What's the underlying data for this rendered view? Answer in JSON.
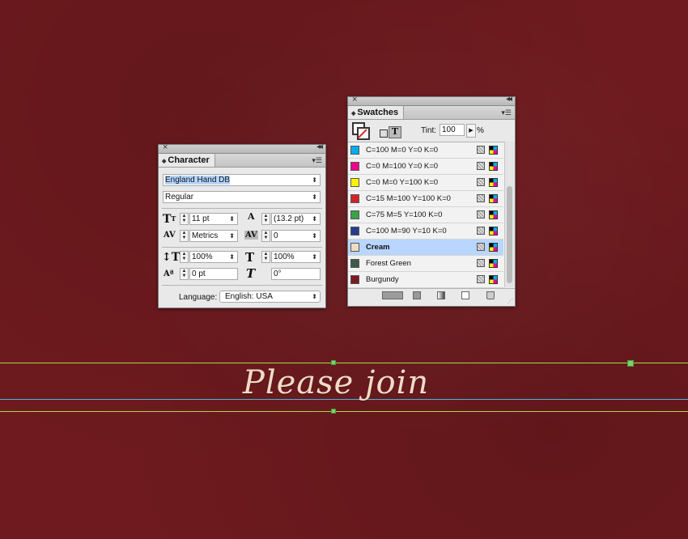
{
  "character_panel": {
    "tab_label": "Character",
    "font_family": "England Hand DB",
    "font_style": "Regular",
    "font_size": "11 pt",
    "leading": "(13.2 pt)",
    "kerning": "Metrics",
    "tracking": "0",
    "vertical_scale": "100%",
    "horizontal_scale": "100%",
    "baseline_shift": "0 pt",
    "skew": "0°",
    "language_label": "Language:",
    "language_value": "English: USA"
  },
  "swatches_panel": {
    "tab_label": "Swatches",
    "tint_label": "Tint:",
    "tint_value": "100",
    "tint_unit": "%",
    "items": [
      {
        "name": "C=100 M=0 Y=0 K=0",
        "color": "#00aeef"
      },
      {
        "name": "C=0 M=100 Y=0 K=0",
        "color": "#ec008c"
      },
      {
        "name": "C=0 M=0 Y=100 K=0",
        "color": "#fff200"
      },
      {
        "name": "C=15 M=100 Y=100 K=0",
        "color": "#d2232a"
      },
      {
        "name": "C=75 M=5 Y=100 K=0",
        "color": "#3aa346"
      },
      {
        "name": "C=100 M=90 Y=10 K=0",
        "color": "#283d8f"
      },
      {
        "name": "Cream",
        "color": "#f1dbc5",
        "selected": true
      },
      {
        "name": "Forest Green",
        "color": "#3e5a4a"
      },
      {
        "name": "Burgundy",
        "color": "#7a1a22"
      }
    ]
  },
  "canvas": {
    "headline": "Please join",
    "text_color": "#f1dbc5",
    "background_color": "#6e1a1e",
    "guide_color_green": "#a8d84a",
    "guide_color_blue": "#4fb3d9"
  }
}
